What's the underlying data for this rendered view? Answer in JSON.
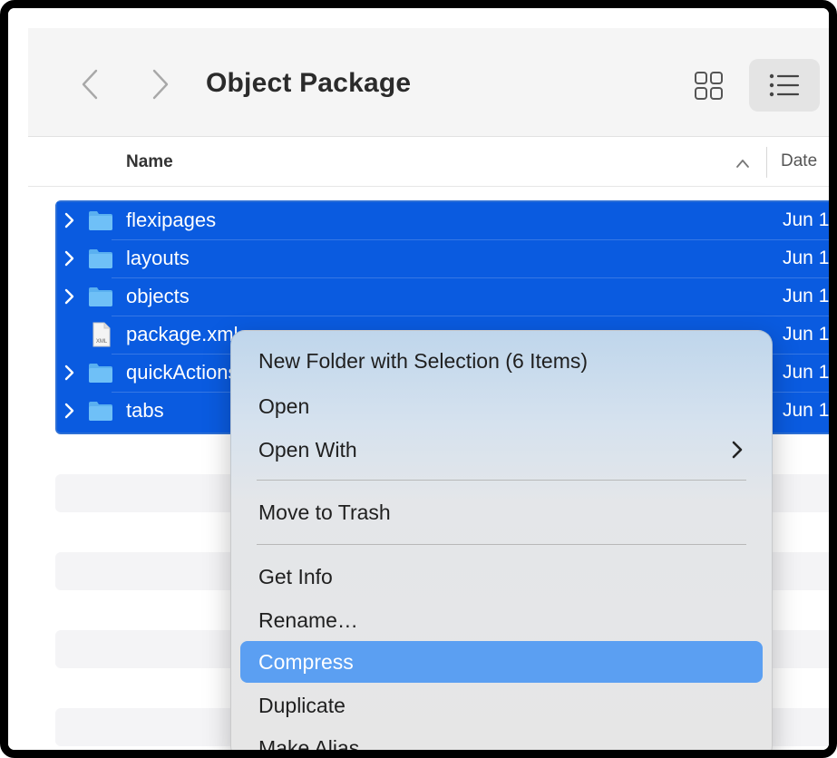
{
  "toolbar": {
    "title": "Object Package"
  },
  "columns": {
    "name": "Name",
    "date": "Date"
  },
  "files": [
    {
      "name": "flexipages",
      "date": "Jun 1",
      "type": "folder"
    },
    {
      "name": "layouts",
      "date": "Jun 1",
      "type": "folder"
    },
    {
      "name": "objects",
      "date": "Jun 1",
      "type": "folder"
    },
    {
      "name": "package.xml",
      "date": "Jun 1",
      "type": "xml-file",
      "icon_label": "XML"
    },
    {
      "name": "quickActions",
      "date": "Jun 1",
      "type": "folder"
    },
    {
      "name": "tabs",
      "date": "Jun 1",
      "type": "folder"
    }
  ],
  "context_menu": {
    "items": [
      {
        "label": "New Folder with Selection (6 Items)"
      },
      {
        "label": "Open"
      },
      {
        "label": "Open With",
        "has_submenu": true
      },
      {
        "label": "Move to Trash"
      },
      {
        "label": "Get Info"
      },
      {
        "label": "Rename…"
      },
      {
        "label": "Compress",
        "highlighted": true
      },
      {
        "label": "Duplicate"
      },
      {
        "label": "Make Alias"
      }
    ]
  },
  "colors": {
    "selection": "#0a5be0",
    "menu_highlight": "#5b9ff2",
    "folder_icon": "#5ab0f0"
  }
}
